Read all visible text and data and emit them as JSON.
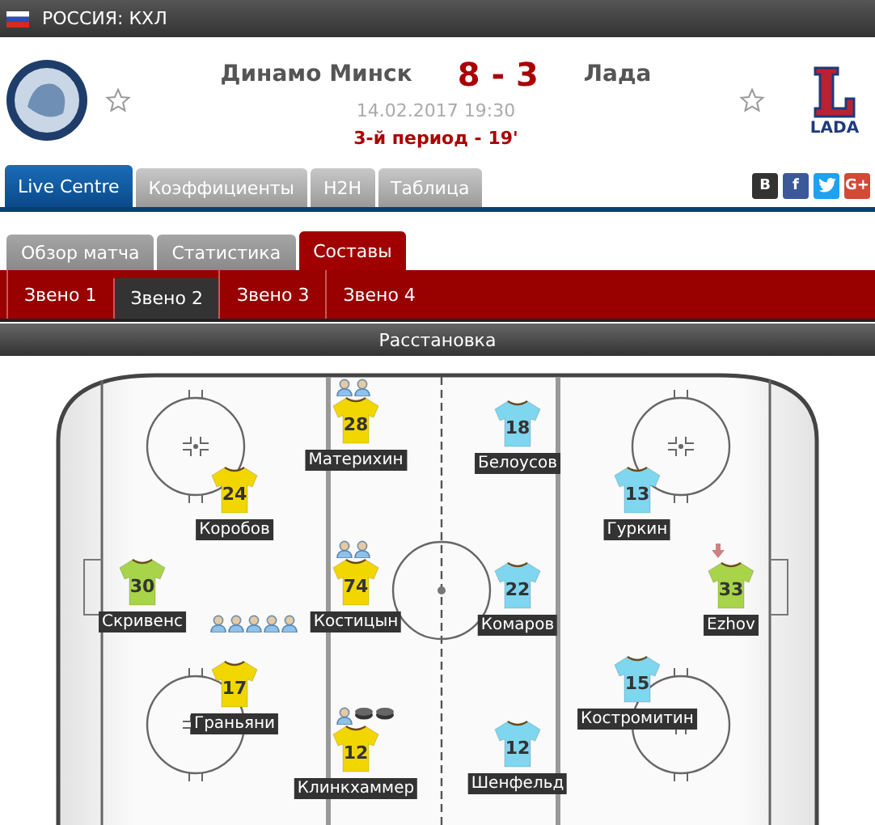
{
  "league": {
    "country": "РОССИЯ: КХЛ"
  },
  "match": {
    "home": "Динамо Минск",
    "score": "8 - 3",
    "away": "Лада",
    "date": "14.02.2017 19:30",
    "status": "3-й период - 19'",
    "away_logo_text": "LADA"
  },
  "tabs": [
    {
      "label": "Live Centre",
      "selected": true
    },
    {
      "label": "Коэффициенты",
      "selected": false
    },
    {
      "label": "H2H",
      "selected": false
    },
    {
      "label": "Таблица",
      "selected": false
    }
  ],
  "share": [
    {
      "kind": "vk",
      "label": "B"
    },
    {
      "kind": "facebook",
      "label": "f"
    },
    {
      "kind": "twitter"
    },
    {
      "kind": "google",
      "label": "G+"
    }
  ],
  "subtabs": [
    {
      "label": "Обзор матча",
      "selected": false
    },
    {
      "label": "Статистика",
      "selected": false
    },
    {
      "label": "Составы",
      "selected": true
    }
  ],
  "lines": [
    {
      "label": "Звено 1",
      "selected": false
    },
    {
      "label": "Звено 2",
      "selected": true
    },
    {
      "label": "Звено 3",
      "selected": false
    },
    {
      "label": "Звено 4",
      "selected": false
    }
  ],
  "section_title": "Расстановка",
  "home_players": [
    {
      "name": "Материхин",
      "number": "28",
      "color": "#f2d600",
      "events": [
        {
          "kind": "assist"
        },
        {
          "kind": "assist"
        }
      ]
    },
    {
      "name": "Коробов",
      "number": "24",
      "color": "#f2d600"
    },
    {
      "name": "Скривенс",
      "number": "30",
      "color": "#a8d44a",
      "events": [
        {
          "kind": "assist"
        },
        {
          "kind": "assist"
        },
        {
          "kind": "assist"
        },
        {
          "kind": "assist"
        },
        {
          "kind": "assist"
        }
      ]
    },
    {
      "name": "Костицын",
      "number": "74",
      "color": "#f2d600",
      "events": [
        {
          "kind": "assist"
        },
        {
          "kind": "assist"
        }
      ]
    },
    {
      "name": "Граньяни",
      "number": "17",
      "color": "#f2d600"
    },
    {
      "name": "Клинкхаммер",
      "number": "12",
      "color": "#f2d600",
      "events": [
        {
          "kind": "assist"
        },
        {
          "kind": "goal"
        },
        {
          "kind": "goal"
        }
      ]
    }
  ],
  "away_players": [
    {
      "name": "Белоусов",
      "number": "18",
      "color": "#7fd6ef"
    },
    {
      "name": "Гуркин",
      "number": "13",
      "color": "#7fd6ef"
    },
    {
      "name": "Комаров",
      "number": "22",
      "color": "#7fd6ef"
    },
    {
      "name": "Ezhov",
      "number": "33",
      "color": "#a8d44a",
      "events": [
        {
          "kind": "substitution"
        }
      ]
    },
    {
      "name": "Костромитин",
      "number": "15",
      "color": "#7fd6ef"
    },
    {
      "name": "Шенфельд",
      "number": "12",
      "color": "#7fd6ef"
    }
  ]
}
